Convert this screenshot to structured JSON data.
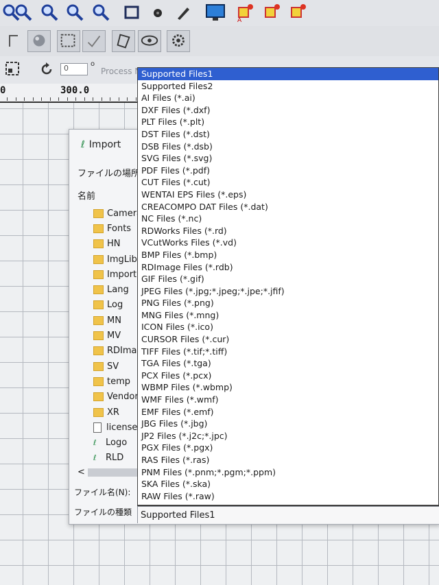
{
  "toolbar_top": {
    "icons": [
      "zoom-in-icon",
      "zoom-out-icon",
      "zoom-fit-icon",
      "zoom-select-icon",
      "zoom-icon",
      "rectangle-icon",
      "record-icon",
      "pen-icon",
      "monitor-icon",
      "layer-a-icon",
      "layer-b-icon",
      "layer-c-icon"
    ]
  },
  "toolbar_second": {
    "icons": [
      "corner-icon",
      "sphere-icon",
      "dotted-select-icon",
      "check-marks-icon",
      "eraser-icon",
      "eye-icon",
      "gear-icon"
    ]
  },
  "toolbar_third": {
    "rotation_value": "0",
    "degree_symbol": "o",
    "process_label": "Process N"
  },
  "ruler": {
    "left_mark": "0",
    "value": "300.0"
  },
  "dialog": {
    "title": "Import",
    "location_label": "ファイルの場所(",
    "name_header": "名前",
    "files": [
      {
        "name": "Camera",
        "kind": "folder"
      },
      {
        "name": "Fonts",
        "kind": "folder"
      },
      {
        "name": "HN",
        "kind": "folder"
      },
      {
        "name": "ImgLib",
        "kind": "folder"
      },
      {
        "name": "Import",
        "kind": "folder"
      },
      {
        "name": "Lang",
        "kind": "folder"
      },
      {
        "name": "Log",
        "kind": "folder"
      },
      {
        "name": "MN",
        "kind": "folder"
      },
      {
        "name": "MV",
        "kind": "folder"
      },
      {
        "name": "RDImag",
        "kind": "folder"
      },
      {
        "name": "SV",
        "kind": "folder"
      },
      {
        "name": "temp",
        "kind": "folder"
      },
      {
        "name": "Vendor",
        "kind": "folder"
      },
      {
        "name": "XR",
        "kind": "folder"
      },
      {
        "name": "license",
        "kind": "file"
      },
      {
        "name": "Logo",
        "kind": "app"
      },
      {
        "name": "RLD",
        "kind": "app"
      }
    ],
    "scroll_left": "<",
    "filename_label": "ファイル名(N):",
    "filetype_label": "ファイルの種類",
    "filetype_value": "Supported Files1"
  },
  "dropdown": {
    "selected_index": 0,
    "options": [
      "Supported Files1",
      "Supported Files2",
      "AI Files (*.ai)",
      "DXF Files (*.dxf)",
      "PLT Files (*.plt)",
      "DST Files (*.dst)",
      "DSB Files (*.dsb)",
      "SVG Files (*.svg)",
      "PDF Files (*.pdf)",
      "CUT Files (*.cut)",
      "WENTAI EPS Files (*.eps)",
      "CREACOMPO DAT Files (*.dat)",
      "NC Files (*.nc)",
      "RDWorks Files (*.rd)",
      "VCutWorks Files (*.vd)",
      "BMP Files (*.bmp)",
      "RDImage Files (*.rdb)",
      "GIF Files (*.gif)",
      "JPEG Files (*.jpg;*.jpeg;*.jpe;*.jfif)",
      "PNG Files (*.png)",
      "MNG Files (*.mng)",
      "ICON Files (*.ico)",
      "CURSOR Files (*.cur)",
      "TIFF Files (*.tif;*.tiff)",
      "TGA Files (*.tga)",
      "PCX Files (*.pcx)",
      "WBMP Files (*.wbmp)",
      "WMF Files (*.wmf)",
      "EMF Files (*.emf)",
      "JBG Files (*.jbg)",
      "JP2 Files (*.j2c;*.jpc)",
      "PGX Files (*.pgx)",
      "RAS Files (*.ras)",
      "PNM Files (*.pnm;*.pgm;*.ppm)",
      "SKA Files (*.ska)",
      "RAW Files (*.raw)"
    ]
  },
  "colors": {
    "selection": "#2f5fd0",
    "folder": "#f0c34a"
  }
}
